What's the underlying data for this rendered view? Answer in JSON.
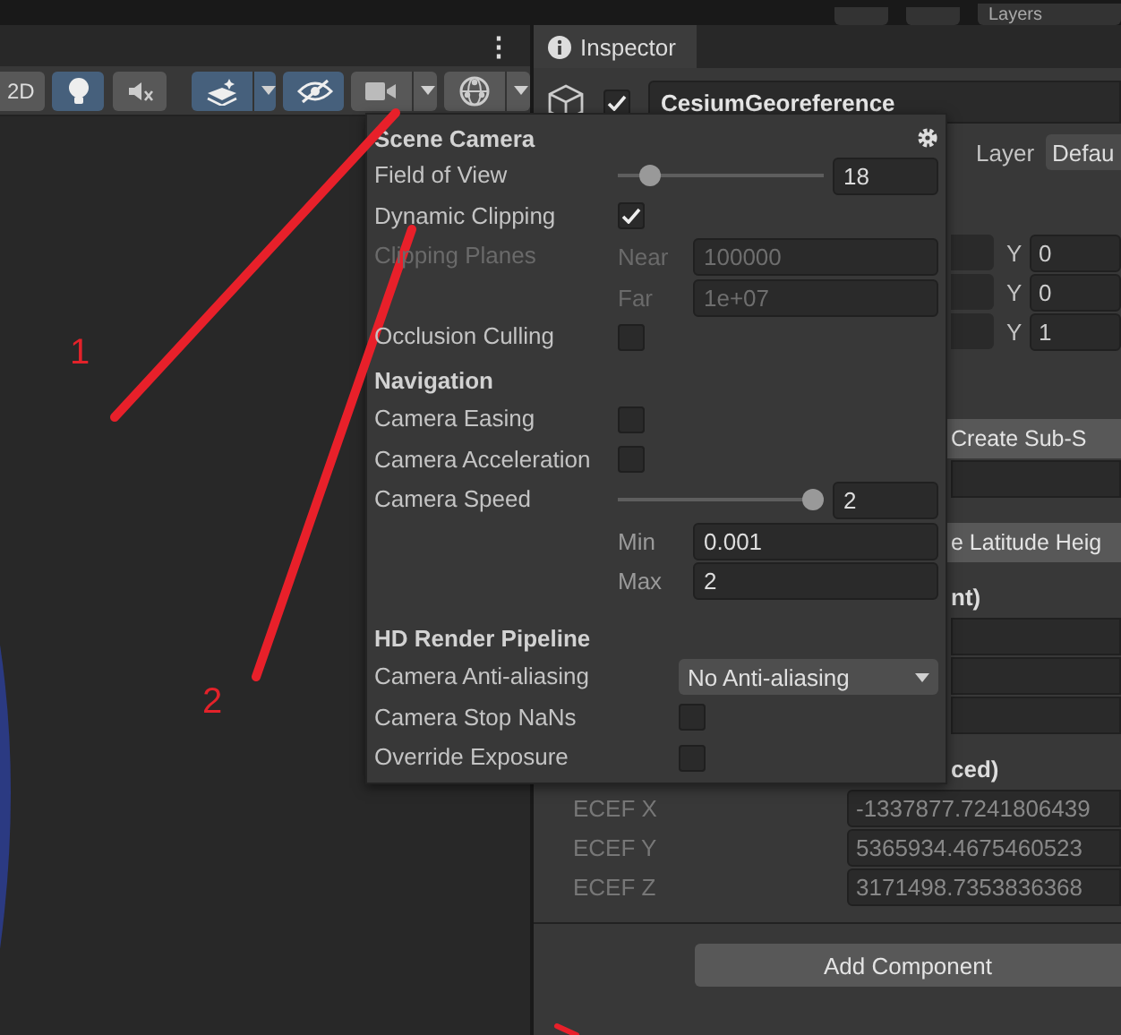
{
  "top_bar": {
    "layers_dropdown": "Layers"
  },
  "scene_view": {
    "menu_glyph": "⋮",
    "toolbar": [
      {
        "kind": "label",
        "label": "2D",
        "selected": false,
        "dropdown": false
      },
      {
        "kind": "light",
        "selected": true,
        "dropdown": false
      },
      {
        "kind": "audio",
        "selected": false,
        "dropdown": false
      },
      {
        "kind": "effects",
        "selected": true,
        "dropdown": true
      },
      {
        "kind": "visibility",
        "selected": true,
        "dropdown": false
      },
      {
        "kind": "camera",
        "selected": false,
        "dropdown": true
      },
      {
        "kind": "gizmo",
        "selected": false,
        "dropdown": true
      }
    ]
  },
  "inspector": {
    "tab": "Inspector",
    "object": {
      "enabled": true,
      "name": "CesiumGeoreference"
    },
    "layer": {
      "label": "Layer",
      "value": "Defau"
    },
    "rows": [
      {
        "kind": "xy",
        "axis": "Y",
        "value": "0"
      },
      {
        "kind": "xy",
        "axis": "Y",
        "value": "0"
      },
      {
        "kind": "xy",
        "axis": "Y",
        "value": "1"
      },
      {
        "kind": "button",
        "label": "Create Sub-S"
      },
      {
        "kind": "field"
      },
      {
        "kind": "button",
        "label": "e Latitude Heig"
      },
      {
        "kind": "text",
        "label": "nt)"
      },
      {
        "kind": "field"
      },
      {
        "kind": "field"
      },
      {
        "kind": "field"
      },
      {
        "kind": "text",
        "label": "ced)"
      },
      {
        "kind": "readonly",
        "label": "ECEF X",
        "value": "-1337877.7241806439"
      },
      {
        "kind": "readonly",
        "label": "ECEF Y",
        "value": "5365934.4675460523"
      },
      {
        "kind": "readonly",
        "label": "ECEF Z",
        "value": "3171498.7353836368"
      }
    ],
    "add_button": "Add Component"
  },
  "popup": {
    "sections": [
      {
        "heading": "Scene Camera",
        "rows": [
          {
            "kind": "slider",
            "label": "Field of View",
            "level": 0.12,
            "value": "18"
          },
          {
            "kind": "checkbox",
            "label": "Dynamic Clipping",
            "checked": true
          },
          {
            "kind": "fields",
            "label": "Clipping Planes",
            "disabled": true,
            "fields": [
              {
                "label": "Near",
                "value": "100000"
              },
              {
                "label": "Far",
                "value": "1e+07"
              }
            ]
          },
          {
            "kind": "checkbox",
            "label": "Occlusion Culling",
            "checked": false
          }
        ]
      },
      {
        "heading": "Navigation",
        "rows": [
          {
            "kind": "checkbox",
            "label": "Camera Easing",
            "checked": false
          },
          {
            "kind": "checkbox",
            "label": "Camera Acceleration",
            "checked": false
          },
          {
            "kind": "slider",
            "label": "Camera Speed",
            "level": 1,
            "value": "2"
          },
          {
            "kind": "fields",
            "disabled": false,
            "fields": [
              {
                "label": "Min",
                "value": "0.001"
              },
              {
                "label": "Max",
                "value": "2"
              }
            ]
          }
        ]
      },
      {
        "heading": "HD Render Pipeline",
        "rows": [
          {
            "kind": "dropdown",
            "label": "Camera Anti-aliasing",
            "value": "No Anti-aliasing"
          },
          {
            "kind": "checkbox",
            "label": "Camera Stop NaNs",
            "checked": false
          },
          {
            "kind": "checkbox",
            "label": "Override Exposure",
            "checked": false
          }
        ]
      }
    ]
  },
  "annotations": [
    {
      "label": "1"
    },
    {
      "label": "2"
    }
  ]
}
